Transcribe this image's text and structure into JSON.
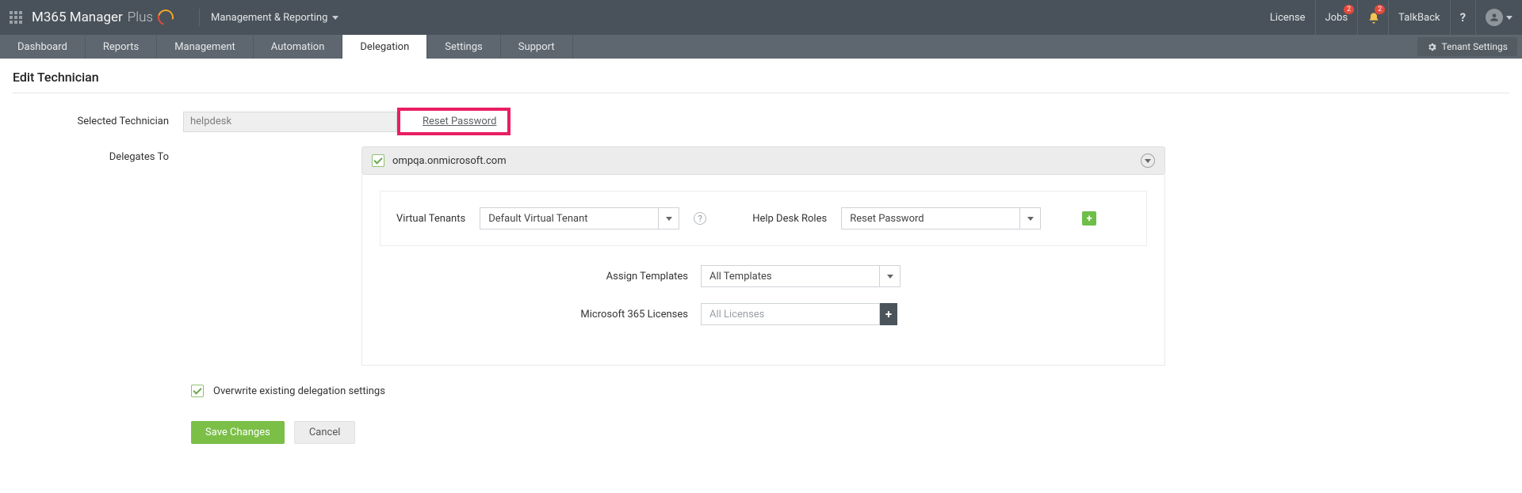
{
  "header": {
    "brand_primary": "M365 Manager",
    "brand_secondary": "Plus",
    "context_menu": "Management & Reporting",
    "right": {
      "license": "License",
      "jobs": "Jobs",
      "jobs_badge": "2",
      "notif_badge": "2",
      "talkback": "TalkBack",
      "help": "?"
    }
  },
  "nav": {
    "tabs": [
      "Dashboard",
      "Reports",
      "Management",
      "Automation",
      "Delegation",
      "Settings",
      "Support"
    ],
    "active_index": 4,
    "tenant_settings": "Tenant Settings"
  },
  "page": {
    "title": "Edit Technician",
    "selected_tech_label": "Selected Technician",
    "selected_tech_value": "helpdesk",
    "reset_password": "Reset Password",
    "delegates_to_label": "Delegates To",
    "tenant_name": "ompqa.onmicrosoft.com",
    "virtual_tenants_label": "Virtual Tenants",
    "virtual_tenants_value": "Default Virtual Tenant",
    "helpdesk_roles_label": "Help Desk Roles",
    "helpdesk_roles_value": "Reset Password",
    "assign_templates_label": "Assign Templates",
    "assign_templates_value": "All Templates",
    "licenses_label": "Microsoft 365 Licenses",
    "licenses_placeholder": "All Licenses",
    "overwrite_label": "Overwrite existing delegation settings",
    "save": "Save Changes",
    "cancel": "Cancel"
  }
}
